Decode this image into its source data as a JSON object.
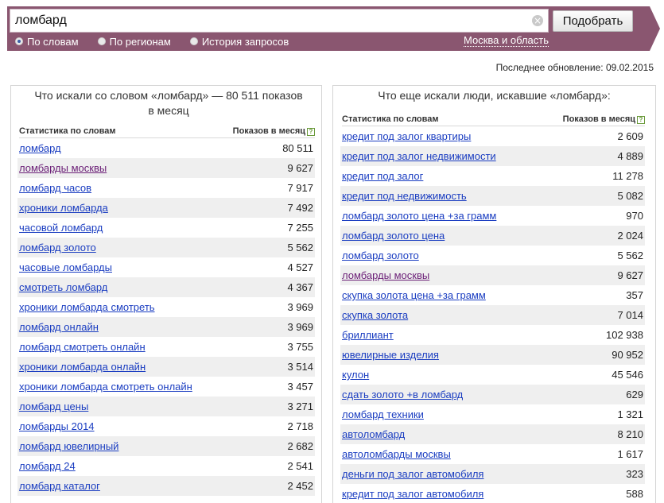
{
  "search": {
    "value": "ломбард",
    "button": "Подобрать",
    "clear_icon": "clear-icon"
  },
  "modes": [
    {
      "label": "По словам",
      "selected": true
    },
    {
      "label": "По регионам",
      "selected": false
    },
    {
      "label": "История запросов",
      "selected": false
    }
  ],
  "region": "Москва и область",
  "updated": "Последнее обновление: 09.02.2015",
  "left": {
    "title": "Что искали со словом «ломбард» — 80 511 показов в месяц",
    "col1": "Статистика по словам",
    "col2": "Показов в месяц",
    "rows": [
      {
        "q": "ломбард",
        "n": "80 511",
        "v": false
      },
      {
        "q": "ломбарды москвы",
        "n": "9 627",
        "v": true
      },
      {
        "q": "ломбард часов",
        "n": "7 917",
        "v": false
      },
      {
        "q": "хроники ломбарда",
        "n": "7 492",
        "v": false
      },
      {
        "q": "часовой ломбард",
        "n": "7 255",
        "v": false
      },
      {
        "q": "ломбард золото",
        "n": "5 562",
        "v": false
      },
      {
        "q": "часовые ломбарды",
        "n": "4 527",
        "v": false
      },
      {
        "q": "смотреть ломбард",
        "n": "4 367",
        "v": false
      },
      {
        "q": "хроники ломбарда смотреть",
        "n": "3 969",
        "v": false
      },
      {
        "q": "ломбард онлайн",
        "n": "3 969",
        "v": false
      },
      {
        "q": "ломбард смотреть онлайн",
        "n": "3 755",
        "v": false
      },
      {
        "q": "хроники ломбарда онлайн",
        "n": "3 514",
        "v": false
      },
      {
        "q": "хроники ломбарда смотреть онлайн",
        "n": "3 457",
        "v": false
      },
      {
        "q": "ломбард цены",
        "n": "3 271",
        "v": false
      },
      {
        "q": "ломбарды 2014",
        "n": "2 718",
        "v": false
      },
      {
        "q": "ломбард ювелирный",
        "n": "2 682",
        "v": false
      },
      {
        "q": "ломбард 24",
        "n": "2 541",
        "v": false
      },
      {
        "q": "ломбард каталог",
        "n": "2 452",
        "v": false
      }
    ]
  },
  "right": {
    "title": "Что еще искали люди, искавшие «ломбард»:",
    "col1": "Статистика по словам",
    "col2": "Показов в месяц",
    "rows": [
      {
        "q": "кредит под залог квартиры",
        "n": "2 609",
        "v": false
      },
      {
        "q": "кредит под залог недвижимости",
        "n": "4 889",
        "v": false
      },
      {
        "q": "кредит под залог",
        "n": "11 278",
        "v": false
      },
      {
        "q": "кредит под недвижимость",
        "n": "5 082",
        "v": false
      },
      {
        "q": "ломбард золото цена +за грамм",
        "n": "970",
        "v": false
      },
      {
        "q": "ломбард золото цена",
        "n": "2 024",
        "v": false
      },
      {
        "q": "ломбард золото",
        "n": "5 562",
        "v": false
      },
      {
        "q": "ломбарды москвы",
        "n": "9 627",
        "v": true
      },
      {
        "q": "скупка золота цена +за грамм",
        "n": "357",
        "v": false
      },
      {
        "q": "скупка золота",
        "n": "7 014",
        "v": false
      },
      {
        "q": "бриллиант",
        "n": "102 938",
        "v": false
      },
      {
        "q": "ювелирные изделия",
        "n": "90 952",
        "v": false
      },
      {
        "q": "кулон",
        "n": "45 546",
        "v": false
      },
      {
        "q": "сдать золото +в ломбард",
        "n": "629",
        "v": false
      },
      {
        "q": "ломбард техники",
        "n": "1 321",
        "v": false
      },
      {
        "q": "автоломбард",
        "n": "8 210",
        "v": false
      },
      {
        "q": "автоломбарды москвы",
        "n": "1 617",
        "v": false
      },
      {
        "q": "деньги под залог автомобиля",
        "n": "323",
        "v": false
      },
      {
        "q": "кредит под залог автомобиля",
        "n": "588",
        "v": false
      }
    ]
  }
}
